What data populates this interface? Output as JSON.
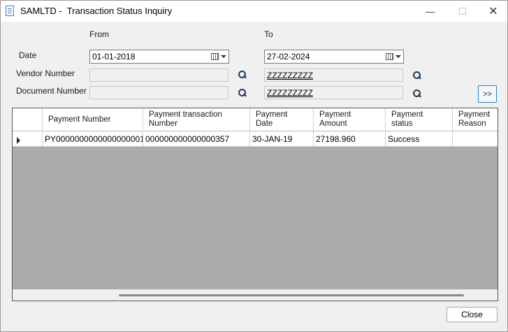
{
  "window": {
    "title": "SAMLTD -  Transaction Status Inquiry",
    "minimize_glyph": "—",
    "close_glyph": "✕"
  },
  "form": {
    "from_label": "From",
    "to_label": "To",
    "date_label": "Date",
    "date_from": "01-01-2018",
    "date_to": "27-02-2024",
    "vendor_label": "Vendor Number",
    "vendor_from": "",
    "vendor_to": "ZZZZZZZZZ",
    "document_label": "Document Number",
    "document_from": "",
    "document_to": "ZZZZZZZZZ",
    "next_button": ">>"
  },
  "grid": {
    "columns": [
      [
        "Payment Number",
        ""
      ],
      [
        "Payment transaction",
        "Number"
      ],
      [
        "Payment",
        "Date"
      ],
      [
        "Payment",
        "Amount"
      ],
      [
        "Payment",
        "status"
      ],
      [
        "Payment",
        "Reason"
      ]
    ],
    "rows": [
      [
        "PY0000000000000000001",
        "000000000000000357",
        "30-JAN-19",
        "27198.960",
        "Success",
        ""
      ]
    ]
  },
  "footer": {
    "close_button": "Close"
  },
  "icons": {
    "window_icon": "document-icon",
    "calendar": "calendar-icon",
    "lookup": "search-icon"
  }
}
